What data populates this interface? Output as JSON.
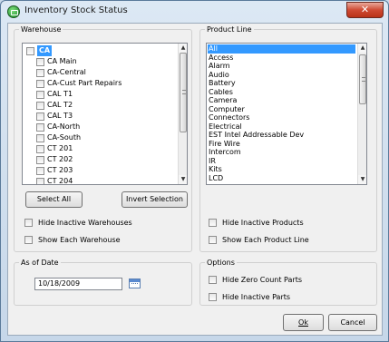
{
  "window": {
    "title": "Inventory Stock Status",
    "close_label": "✕"
  },
  "warehouse": {
    "legend": "Warehouse",
    "items": [
      "CA",
      "CA Main",
      "CA-Central",
      "CA-Cust Part Repairs",
      "CAL T1",
      "CAL T2",
      "CAL T3",
      "CA-North",
      "CA-South",
      "CT 201",
      "CT 202",
      "CT 203",
      "CT 204"
    ],
    "select_all": "Select All",
    "invert_selection": "Invert Selection",
    "hide_inactive": "Hide Inactive Warehouses",
    "show_each": "Show Each Warehouse"
  },
  "product_line": {
    "legend": "Product Line",
    "items": [
      "All",
      "Access",
      "Alarm",
      "Audio",
      "Battery",
      "Cables",
      "Camera",
      "Computer",
      "Connectors",
      "Electrical",
      "EST Intel Addressable Dev",
      "Fire Wire",
      "Intercom",
      "IR",
      "Kits",
      "LCD"
    ],
    "hide_inactive": "Hide Inactive Products",
    "show_each": "Show Each Product Line"
  },
  "as_of_date": {
    "legend": "As of Date",
    "value": "10/18/2009"
  },
  "options": {
    "legend": "Options",
    "hide_zero_count": "Hide Zero Count Parts",
    "hide_inactive_parts": "Hide Inactive Parts"
  },
  "buttons": {
    "ok": "Ok",
    "cancel": "Cancel"
  },
  "colors": {
    "selection": "#3399ff",
    "window_bg": "#f0f0f0",
    "close_button": "#cf4a34"
  }
}
